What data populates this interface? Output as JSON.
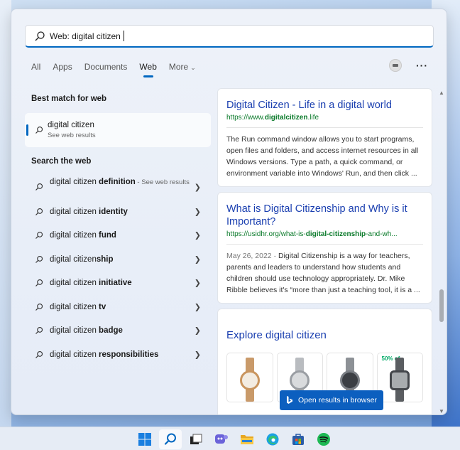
{
  "search": {
    "query": "Web: digital citizen"
  },
  "tabs": [
    {
      "label": "All"
    },
    {
      "label": "Apps"
    },
    {
      "label": "Documents"
    },
    {
      "label": "Web"
    },
    {
      "label": "More"
    }
  ],
  "left": {
    "best_match_title": "Best match for web",
    "best_match": {
      "title": "digital citizen",
      "subtitle": "See web results"
    },
    "search_web_title": "Search the web",
    "suggestions": [
      {
        "prefix": "digital citizen ",
        "bold": "definition",
        "suffix": " - See web results"
      },
      {
        "prefix": "digital citizen ",
        "bold": "identity",
        "suffix": ""
      },
      {
        "prefix": "digital citizen ",
        "bold": "fund",
        "suffix": ""
      },
      {
        "prefix": "digital citizen",
        "bold": "ship",
        "suffix": ""
      },
      {
        "prefix": "digital citizen ",
        "bold": "initiative",
        "suffix": ""
      },
      {
        "prefix": "digital citizen ",
        "bold": "tv",
        "suffix": ""
      },
      {
        "prefix": "digital citizen ",
        "bold": "badge",
        "suffix": ""
      },
      {
        "prefix": "digital citizen ",
        "bold": "responsibilities",
        "suffix": ""
      }
    ]
  },
  "results": [
    {
      "title": "Digital Citizen - Life in a digital world",
      "url_prefix": "https://www.",
      "url_bold": "digitalcitizen",
      "url_suffix": ".life",
      "date": "",
      "body": "The Run command window allows you to start programs, open files and folders, and access internet resources in all Windows versions. Type a path, a quick command, or environment variable into Windows' Run, and then click ..."
    },
    {
      "title": "What is Digital Citizenship and Why is it Important?",
      "url_prefix": "https://usidhr.org/what-is-",
      "url_bold": "digital-citizenship",
      "url_suffix": "-and-wh...",
      "date": "May 26, 2022",
      "body": " · Digital Citizenship is a way for teachers, parents and leaders to understand how students and children should use technology appropriately. Dr. Mike Ribble believes it's “more than just a teaching tool, it is a ..."
    }
  ],
  "explore": {
    "title": "Explore digital citizen",
    "badge": "50% of",
    "open_button": "Open results in browser"
  },
  "colors": {
    "accent": "#0067c0",
    "link": "#1a3fb0",
    "url_green": "#0a7a2a",
    "button": "#0c5fbf"
  },
  "taskbar_icons": [
    "windows-start-icon",
    "search-icon",
    "task-view-icon",
    "teams-chat-icon",
    "file-explorer-icon",
    "edge-icon",
    "microsoft-store-icon",
    "spotify-icon"
  ]
}
